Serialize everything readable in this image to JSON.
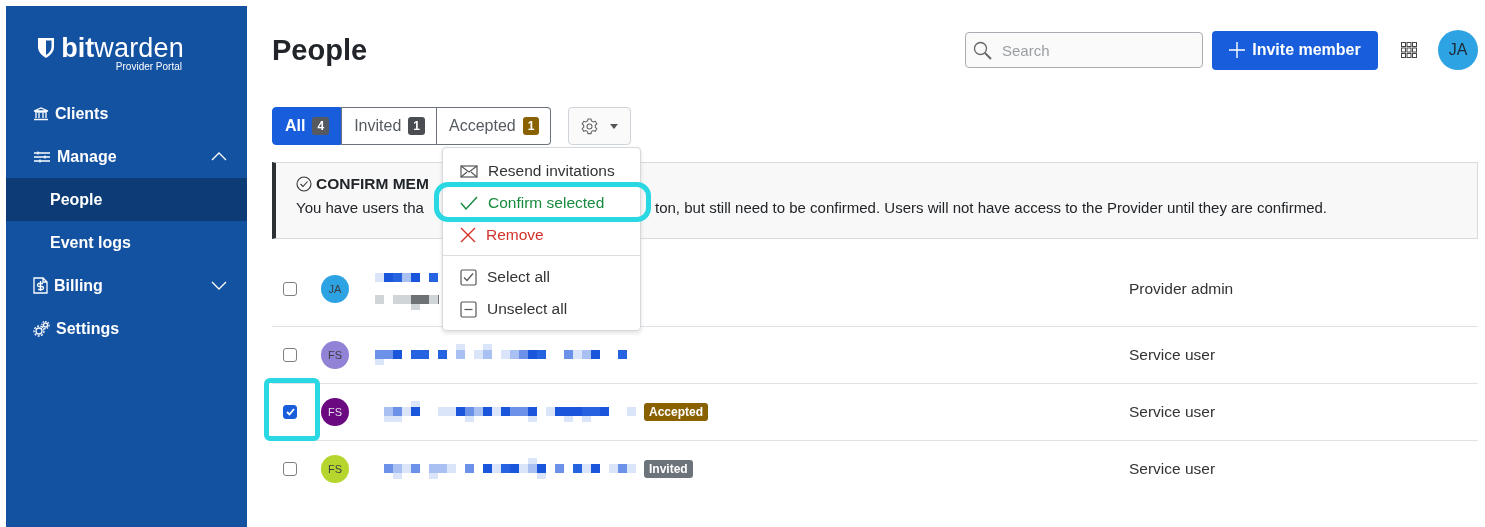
{
  "sidebar": {
    "logo": {
      "brand_bold": "bit",
      "brand_light": "warden",
      "subtitle": "Provider Portal"
    },
    "items": [
      {
        "label": "Clients",
        "selected": false
      },
      {
        "label": "Manage",
        "selected": false,
        "expanded": true,
        "children": [
          {
            "label": "People",
            "selected": true
          },
          {
            "label": "Event logs",
            "selected": false
          }
        ]
      },
      {
        "label": "Billing",
        "selected": false,
        "expanded": false
      },
      {
        "label": "Settings",
        "selected": false
      }
    ]
  },
  "header": {
    "title": "People",
    "search": {
      "placeholder": "Search"
    },
    "invite_button": "Invite member",
    "avatar": {
      "initials": "JA",
      "color": "#2ea3e3"
    }
  },
  "filters": [
    {
      "label": "All",
      "count": "4",
      "selected": true,
      "color": "#555a60"
    },
    {
      "label": "Invited",
      "count": "1",
      "selected": false,
      "color": "#4a4d52"
    },
    {
      "label": "Accepted",
      "count": "1",
      "selected": false,
      "color": "#8a6100"
    }
  ],
  "callout": {
    "title": "CONFIRM MEM",
    "body_start": "You have users tha",
    "body_end": "ton, but still need to be confirmed. Users will not have access to the Provider until they are confirmed."
  },
  "menu": {
    "items": [
      {
        "kind": "action",
        "label": "Resend invitations",
        "color": "#333333",
        "highlighted": false
      },
      {
        "kind": "action",
        "label": "Confirm selected",
        "color": "#178a3e",
        "highlighted": true
      },
      {
        "kind": "action",
        "label": "Remove",
        "color": "#d1322b",
        "highlighted": false
      },
      {
        "kind": "divider"
      },
      {
        "kind": "action",
        "label": "Select all",
        "color": "#333333",
        "highlighted": false
      },
      {
        "kind": "action",
        "label": "Unselect all",
        "color": "#333333",
        "highlighted": false
      }
    ]
  },
  "rows": [
    {
      "kind": "two-line",
      "checked": false,
      "highlighted": false,
      "avatar": "JA",
      "color": "#2ea3e3",
      "role": "Provider admin"
    },
    {
      "kind": "one-line",
      "checked": false,
      "highlighted": false,
      "avatar": "FS",
      "color": "#9283d6",
      "role": "Service user"
    },
    {
      "kind": "one-line",
      "checked": true,
      "highlighted": true,
      "avatar": "FS",
      "color": "#6b0a80",
      "role": "Service user",
      "badge": {
        "label": "Accepted",
        "color": "#8a6100"
      }
    },
    {
      "kind": "one-line",
      "checked": false,
      "highlighted": false,
      "avatar": "FS",
      "color": "#b6d62e",
      "role": "Service user",
      "badge": {
        "label": "Invited",
        "color": "#6c737a"
      }
    }
  ]
}
